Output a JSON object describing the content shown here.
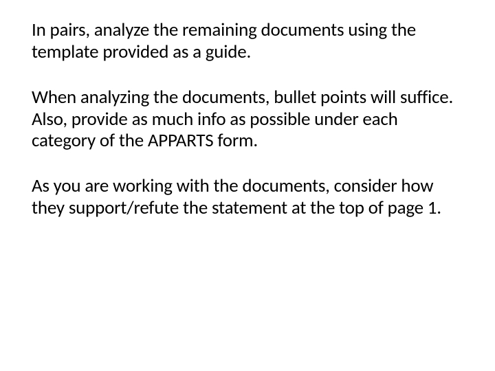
{
  "slide": {
    "paragraphs": [
      "In pairs, analyze the remaining documents using the template provided as a guide.",
      "When analyzing the documents, bullet points will suffice. Also, provide as much info as possible under each category of the APPARTS form.",
      "As you are working with the documents, consider how they support/refute the statement at the top of page 1."
    ]
  }
}
